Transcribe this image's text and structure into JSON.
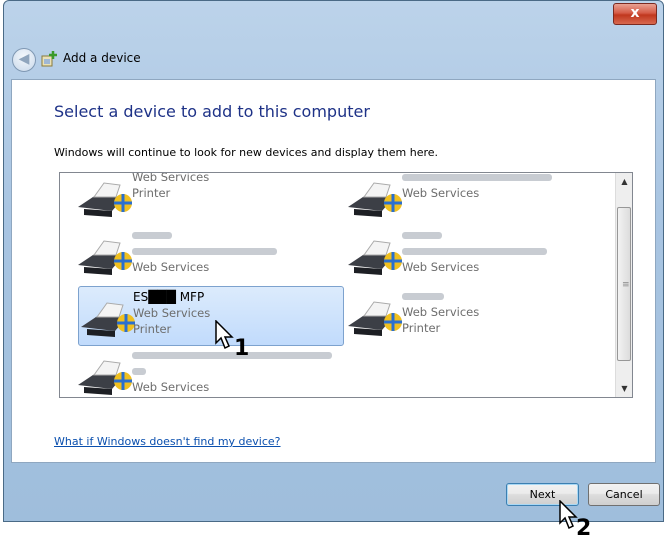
{
  "window": {
    "title": "Add a device",
    "close_label": "x"
  },
  "content": {
    "heading": "Select a device to add to this computer",
    "subtext": "Windows will continue to look for new devices and display them here."
  },
  "devices": [
    {
      "name": "",
      "line2": "Web Services",
      "line3": "Printer"
    },
    {
      "name": "",
      "line2": "Web Services",
      "line3": ""
    },
    {
      "name": "",
      "line2": "",
      "line3": "Web Services"
    },
    {
      "name": "",
      "line2": "",
      "line3": "Web Services"
    },
    {
      "name": "ES███ MFP",
      "line2": "Web Services",
      "line3": "Printer"
    },
    {
      "name": "",
      "line2": "Web Services",
      "line3": "Printer"
    },
    {
      "name": "",
      "line2": "",
      "line3": "Web Services"
    }
  ],
  "help_link": "What if Windows doesn't find my device?",
  "buttons": {
    "next": "Next",
    "cancel": "Cancel"
  },
  "callouts": {
    "one": "1",
    "two": "2"
  },
  "scroll_glyphs": {
    "up": "▲",
    "down": "▼",
    "grip": "≡"
  }
}
